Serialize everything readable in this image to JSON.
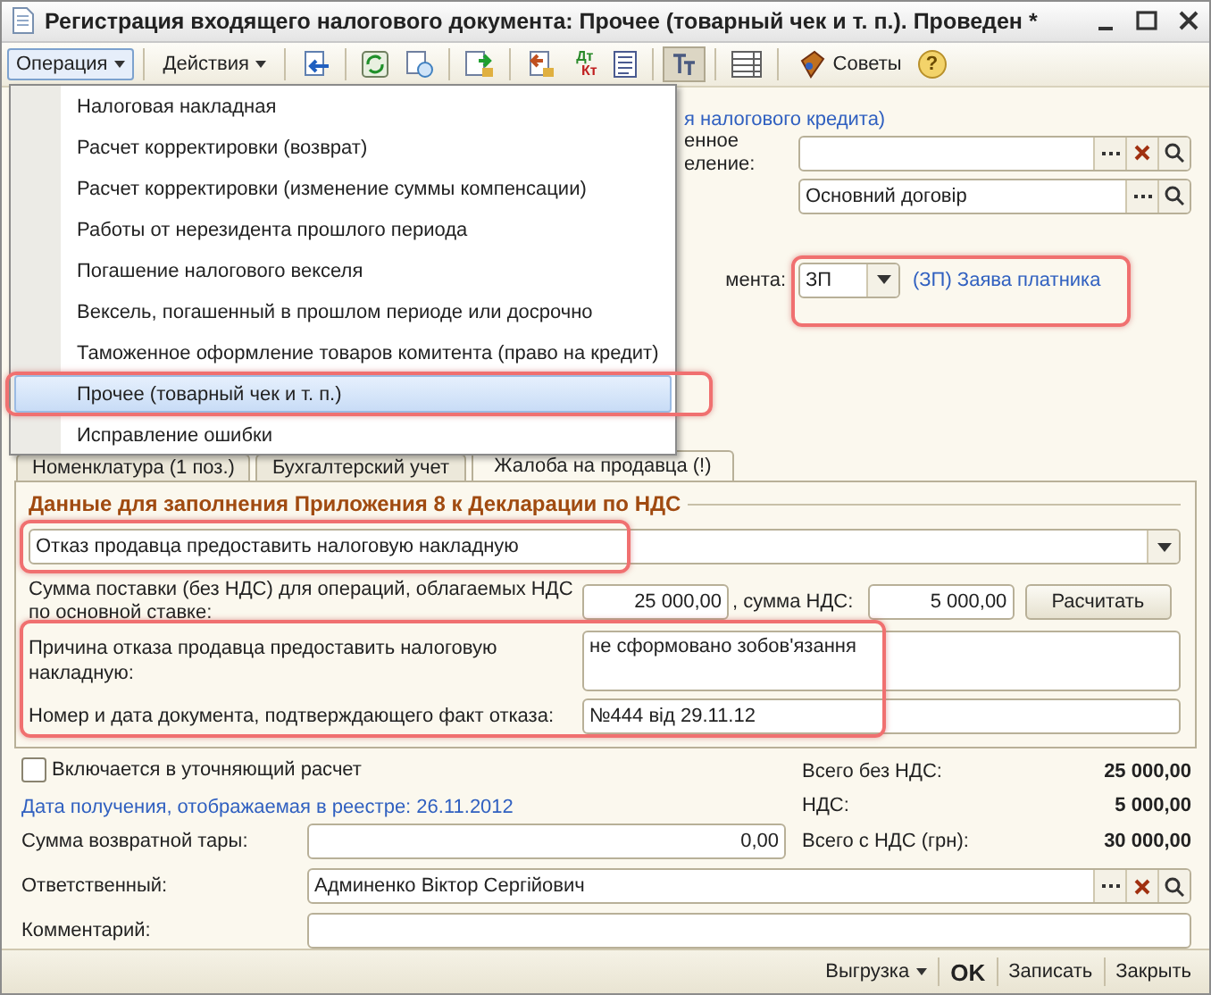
{
  "window": {
    "title": "Регистрация входящего налогового документа: Прочее (товарный чек и т. п.). Проведен *"
  },
  "toolbar": {
    "operation_menu": "Операция",
    "actions_menu": "Действия",
    "dt": "Дт",
    "kt": "Кт",
    "tips_button": "Советы",
    "help_button": "?"
  },
  "operation_menu_items": [
    {
      "label": "Налоговая накладная",
      "selected": false
    },
    {
      "label": "Расчет корректировки (возврат)",
      "selected": false
    },
    {
      "label": "Расчет корректировки (изменение суммы компенсации)",
      "selected": false
    },
    {
      "label": "Работы от нерезидента прошлого периода",
      "selected": false
    },
    {
      "label": "Погашение налогового векселя",
      "selected": false
    },
    {
      "label": "Вексель, погашенный  в прошлом периоде или досрочно",
      "selected": false
    },
    {
      "label": "Таможенное оформление товаров комитента (право на кредит)",
      "selected": false
    },
    {
      "label": "Прочее (товарный чек и т. п.)",
      "selected": true
    },
    {
      "label": "Исправление ошибки",
      "selected": false
    }
  ],
  "header": {
    "link_fragment": "я налогового кредита)",
    "division_label_1": "енное",
    "division_label_2": "еление:",
    "contract_field": "Основний договір",
    "doc_type_label": "мента:",
    "doc_type_value": "ЗП",
    "doc_type_link": "(ЗП) Заява платника"
  },
  "tabs": [
    {
      "label": "Номенклатура (1 поз.)",
      "selected": false
    },
    {
      "label": "Бухгалтерский учет",
      "selected": false
    },
    {
      "label": "Жалоба на продавца (!)",
      "selected": true
    }
  ],
  "panel": {
    "title": "Данные для заполнения Приложения 8 к Декларации по НДС",
    "reason_type": "Отказ продавца предоставить налоговую накладную",
    "supply_label": "Сумма поставки (без НДС) для операций, облагаемых НДС по основной ставке:",
    "supply_amount": "25 000,00",
    "vat_label": ", сумма НДС:",
    "vat_amount": "5 000,00",
    "calc_button": "Расчитать",
    "reason_label": "Причина отказа продавца предоставить налоговую накладную:",
    "reason_value": "не сформовано зобов'язання",
    "doc_label": "Номер и дата документа, подтверждающего факт отказа:",
    "doc_value": "№444 від 29.11.12"
  },
  "form": {
    "refinement": {
      "label": "Включается в уточняющий расчет",
      "checked": false
    },
    "date_link": "Дата получения, отображаемая в реестре: 26.11.2012",
    "tare_label": "Сумма возвратной тары:",
    "tare_value": "0,00",
    "responsible_label": "Ответственный:",
    "responsible_value": "Админенко Віктор Сергійович",
    "comment_label": "Комментарий:"
  },
  "totals": [
    {
      "label": "Всего без НДС:",
      "value": "25 000,00"
    },
    {
      "label": "НДС:",
      "value": "5 000,00"
    },
    {
      "label": "Всего с НДС (грн):",
      "value": "30 000,00"
    }
  ],
  "bottom_buttons": {
    "export": "Выгрузка",
    "ok": "OK",
    "save": "Записать",
    "close": "Закрыть"
  }
}
